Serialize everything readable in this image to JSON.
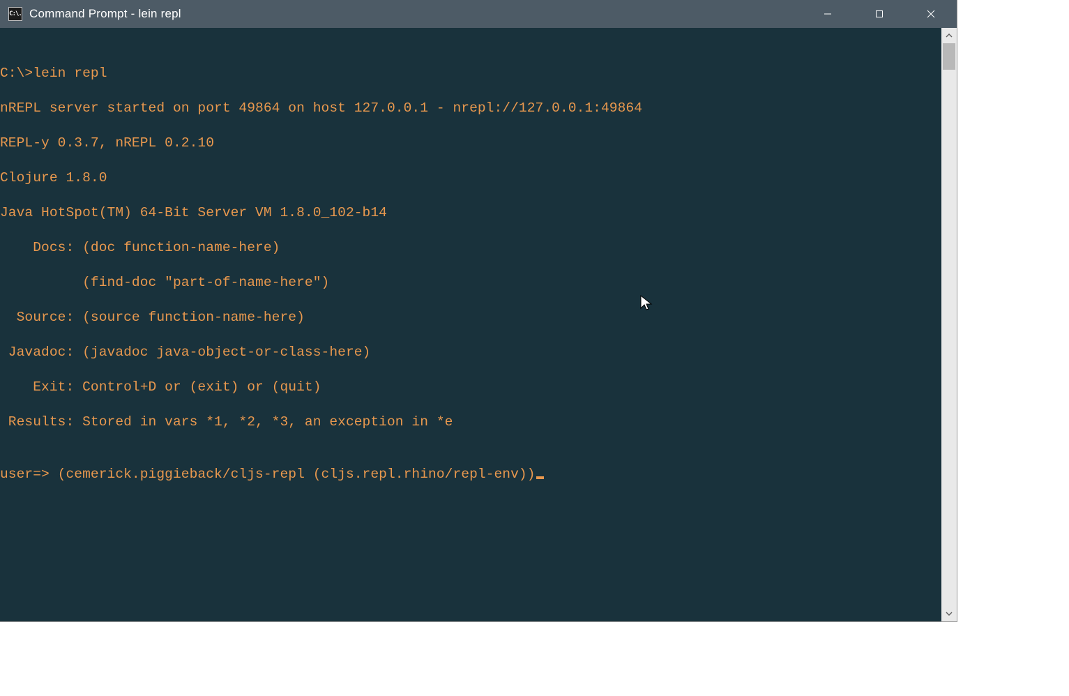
{
  "window": {
    "title": "Command Prompt - lein  repl"
  },
  "terminal": {
    "lines": [
      "C:\\>lein repl",
      "nREPL server started on port 49864 on host 127.0.0.1 - nrepl://127.0.0.1:49864",
      "REPL-y 0.3.7, nREPL 0.2.10",
      "Clojure 1.8.0",
      "Java HotSpot(TM) 64-Bit Server VM 1.8.0_102-b14",
      "    Docs: (doc function-name-here)",
      "          (find-doc \"part-of-name-here\")",
      "  Source: (source function-name-here)",
      " Javadoc: (javadoc java-object-or-class-here)",
      "    Exit: Control+D or (exit) or (quit)",
      " Results: Stored in vars *1, *2, *3, an exception in *e",
      "",
      "user=> (cemerick.piggieback/cljs-repl (cljs.repl.rhino/repl-env))"
    ]
  },
  "icons": {
    "app": "C:\\."
  }
}
